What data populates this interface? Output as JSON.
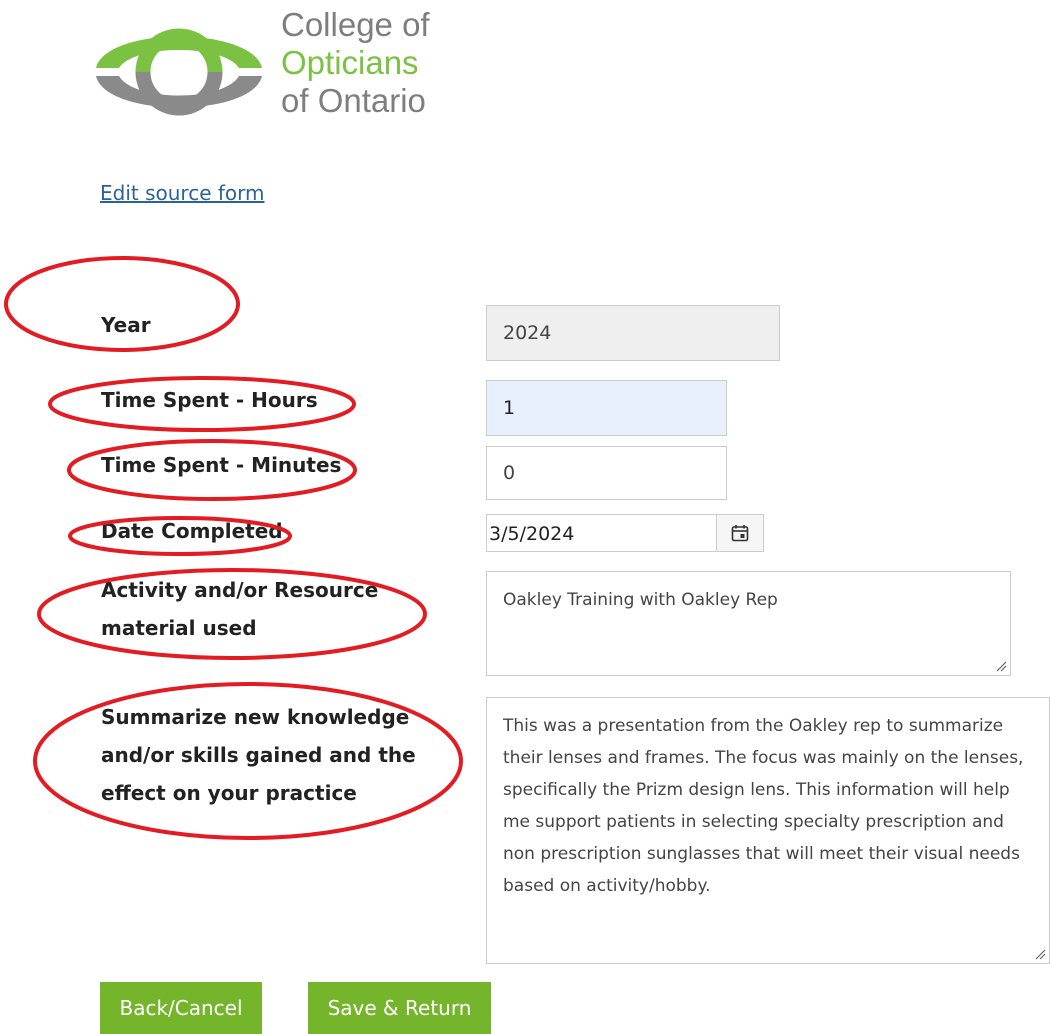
{
  "org": {
    "line1": "College of",
    "line2": "Opticians",
    "line3": "of Ontario"
  },
  "edit_link": "Edit source form",
  "form": {
    "year": {
      "label": "Year",
      "value": "2024"
    },
    "hours": {
      "label": "Time Spent - Hours",
      "value": "1"
    },
    "minutes": {
      "label": "Time Spent - Minutes",
      "value": "0"
    },
    "date": {
      "label": "Date Completed",
      "value": "3/5/2024"
    },
    "activity": {
      "label": "Activity and/or Resource material used",
      "value": "Oakley Training with Oakley Rep"
    },
    "summary": {
      "label": "Summarize new knowledge and/or skills gained and the effect on your practice",
      "value": "This was a presentation from the Oakley rep to summarize their lenses and frames. The focus was mainly on the lenses, specifically the Prizm design lens. This information will help me support patients in selecting specialty prescription and non prescription sunglasses that will meet their visual needs based on activity/hobby."
    }
  },
  "buttons": {
    "back": "Back/Cancel",
    "save": "Save & Return"
  },
  "colors": {
    "brand_green": "#75b52b",
    "logo_green": "#7cc242",
    "logo_gray": "#7e7e7e",
    "annotation_red": "#e31b23",
    "link_blue": "#2a6496"
  },
  "icons": [
    "logo-mark-icon",
    "calendar-icon",
    "resize-grip-icon"
  ]
}
